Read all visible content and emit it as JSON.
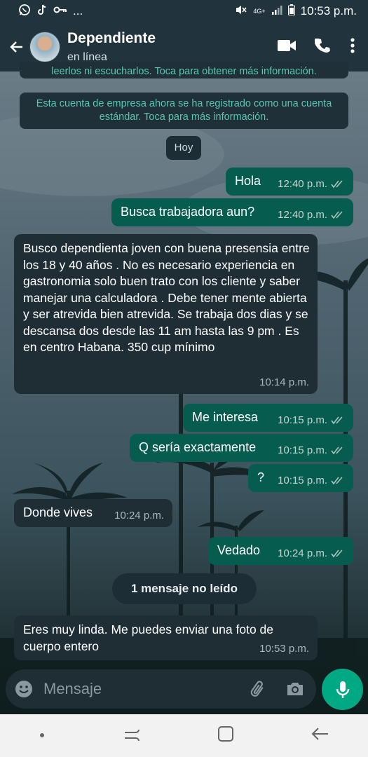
{
  "status_bar": {
    "time": "10:53 p.m.",
    "network": "4G+",
    "overflow": "...",
    "icons": [
      "whatsapp-icon",
      "tiktok-icon",
      "key-icon",
      "mute-icon",
      "signal-icon",
      "battery-icon"
    ]
  },
  "header": {
    "contact_name": "Dependiente",
    "contact_status": "en línea",
    "actions": [
      "video-call-icon",
      "phone-icon",
      "more-vert-icon"
    ]
  },
  "system_messages": {
    "truncated_notice": "leerlos ni escucharlos. Toca para obtener más información.",
    "business_notice": "Esta cuenta de empresa ahora se ha registrado como una cuenta estándar. Toca para más información."
  },
  "day_chip": "Hoy",
  "messages": [
    {
      "direction": "outgoing",
      "text": "Hola",
      "time": "12:40 p.m.",
      "read": true
    },
    {
      "direction": "outgoing",
      "text": "Busca trabajadora aun?",
      "time": "12:40 p.m.",
      "read": true
    },
    {
      "direction": "incoming",
      "text": "Busco dependienta joven con buena presensia entre los 18 y 40 años . No es necesario experiencia en gastronomia solo buen trato con los cliente y saber manejar una calculadora . Debe tener mente abierta y ser atrevida bien atrevida. Se trabaja dos dias y se descansa dos desde las 11 am hasta las 9 pm . Es en centro Habana. 350 cup mínimo",
      "time": "10:14 p.m."
    },
    {
      "direction": "outgoing",
      "text": "Me interesa",
      "time": "10:15 p.m.",
      "read": true
    },
    {
      "direction": "outgoing",
      "text": "Q sería exactamente",
      "time": "10:15 p.m.",
      "read": true
    },
    {
      "direction": "outgoing",
      "text": "?",
      "time": "10:15 p.m.",
      "read": true
    },
    {
      "direction": "incoming",
      "text": "Donde vives",
      "time": "10:24 p.m."
    },
    {
      "direction": "outgoing",
      "text": "Vedado",
      "time": "10:24 p.m.",
      "read": true
    },
    {
      "direction": "incoming",
      "text": "Eres muy linda. Me puedes enviar una foto de cuerpo entero",
      "time": "10:53 p.m."
    }
  ],
  "unread_chip": "1 mensaje no leído",
  "composer": {
    "placeholder": "Mensaje",
    "icons": [
      "emoji-icon",
      "attach-icon",
      "camera-icon",
      "mic-icon"
    ]
  },
  "colors": {
    "header": "#21343e",
    "outgoing_bubble": "#065d4f",
    "incoming_bubble": "#1f2d35",
    "accent": "#00a884",
    "read_ticks": "#a9c4bf",
    "system_text": "#59c7b2"
  }
}
